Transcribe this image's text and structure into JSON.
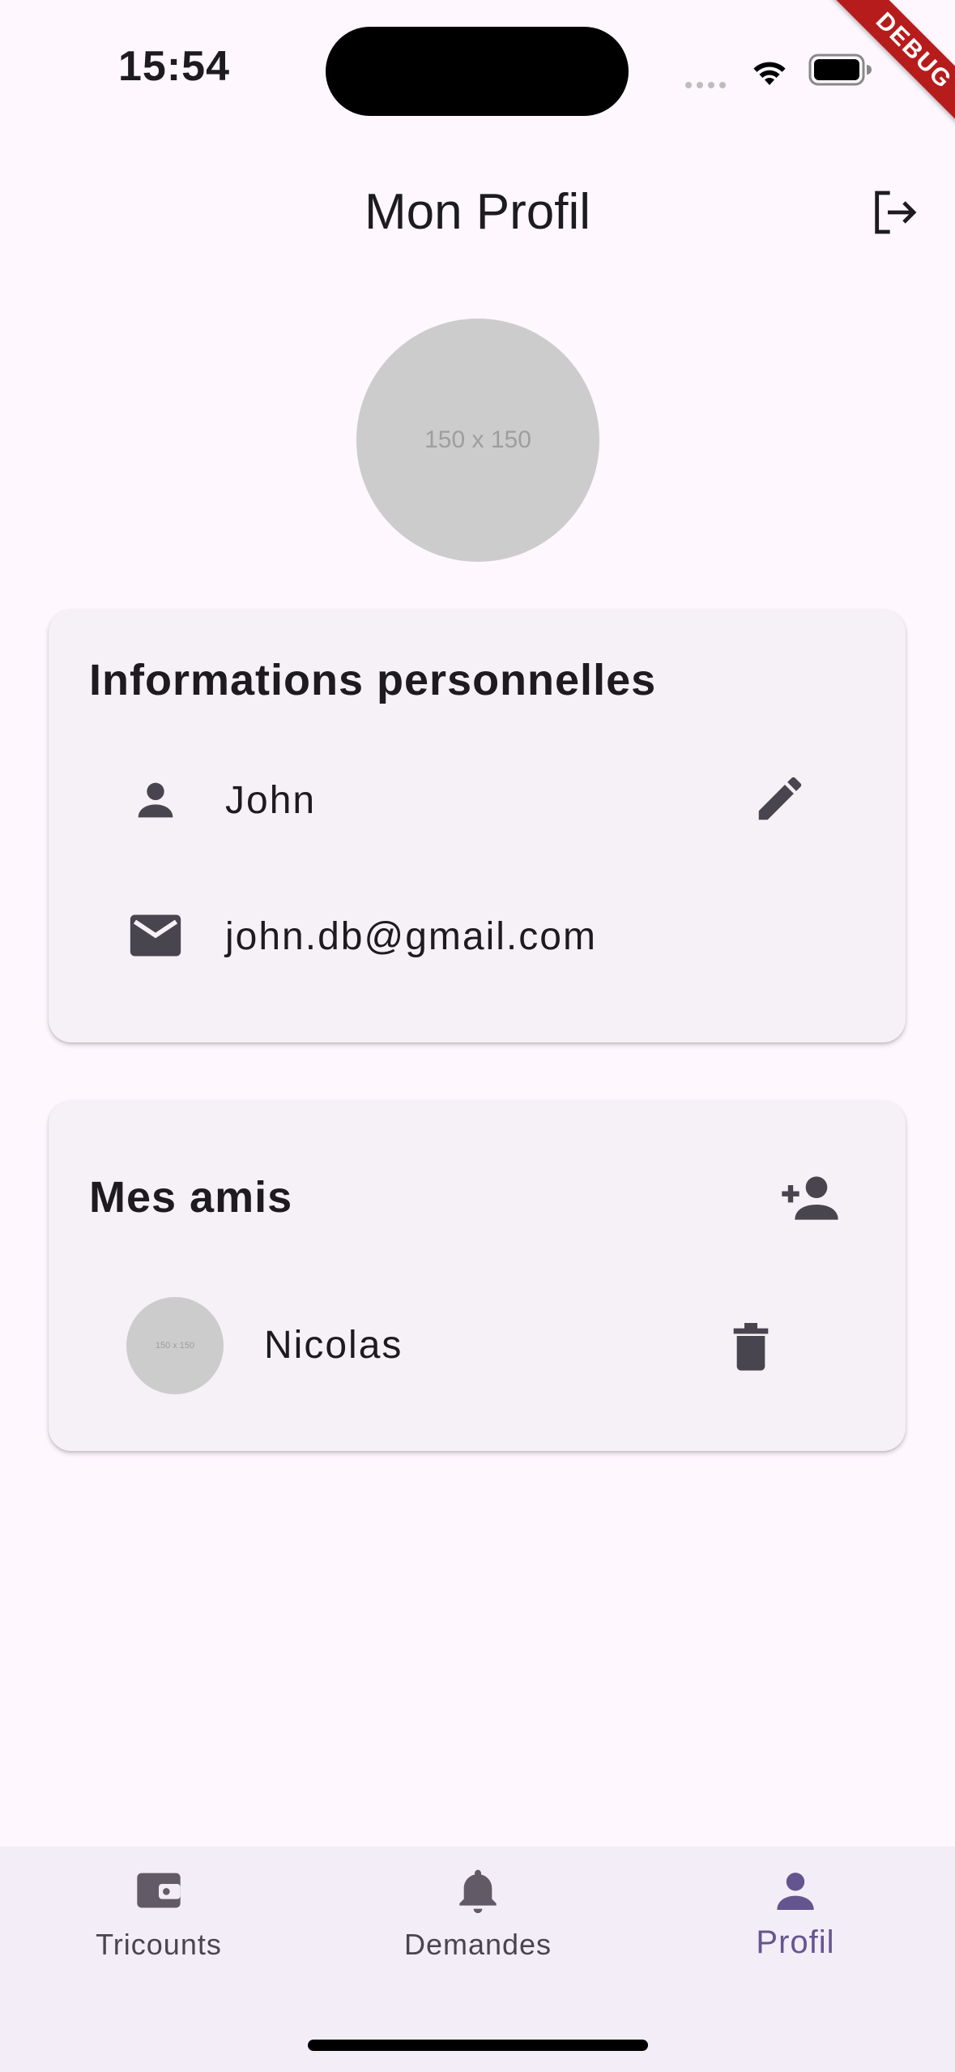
{
  "status_bar": {
    "time": "15:54"
  },
  "debug_banner": {
    "label": "DEBUG"
  },
  "app_bar": {
    "title": "Mon Profil",
    "logout_icon": "logout-icon"
  },
  "profile": {
    "avatar_placeholder": "150 x 150"
  },
  "personal_info": {
    "title": "Informations personnelles",
    "name": "John",
    "email": "john.db@gmail.com"
  },
  "friends": {
    "title": "Mes amis",
    "items": [
      {
        "avatar_placeholder": "150 x 150",
        "name": "Nicolas"
      }
    ]
  },
  "bottom_nav": {
    "items": [
      {
        "label": "Tricounts",
        "icon": "wallet-icon"
      },
      {
        "label": "Demandes",
        "icon": "bell-icon"
      },
      {
        "label": "Profil",
        "icon": "person-icon"
      }
    ],
    "selected": "Profil"
  },
  "colors": {
    "background": "#fef7fe",
    "card": "#f6f1f7",
    "icon": "#49454f",
    "selected_nav": "#65558f",
    "placeholder": "#cccccc"
  }
}
